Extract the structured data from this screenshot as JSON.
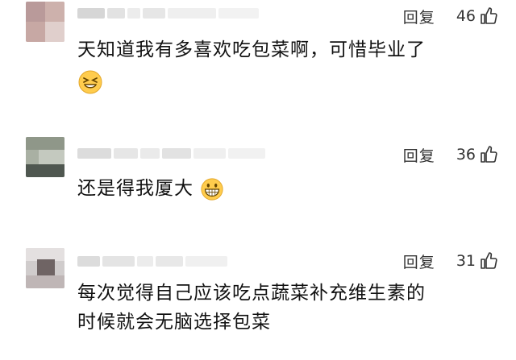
{
  "comments": [
    {
      "reply_label": "回复",
      "likes": "46",
      "text_line1": "天知道我有多喜欢吃包菜啊，可惜毕业了",
      "emoji": "grinning-squint-face-emoji"
    },
    {
      "reply_label": "回复",
      "likes": "36",
      "text_line1": "还是得我厦大",
      "emoji": "grinning-face-emoji"
    },
    {
      "reply_label": "回复",
      "likes": "31",
      "text_line1": "每次觉得自己应该吃点蔬菜补充维生素的",
      "text_line2": "时候就会无脑选择包菜"
    }
  ],
  "icons": {
    "like": "thumbs-up-icon",
    "avatar": "blurred-avatar"
  }
}
